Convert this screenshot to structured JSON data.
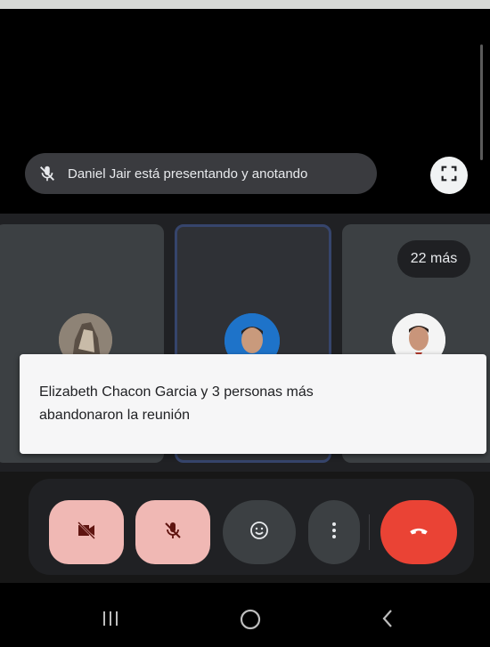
{
  "presentation": {
    "presenter_text": "Daniel Jair está presentando y anotando",
    "icons": {
      "mic_off": "mic-off-icon",
      "fullscreen": "fullscreen-icon"
    }
  },
  "participants": {
    "more_label": "22 más"
  },
  "toast": {
    "line1": "Elizabeth Chacon Garcia y 3 personas más",
    "line2": "abandonaron la reunión"
  },
  "controls": {
    "camera": "camera-off-icon",
    "microphone": "mic-off-icon",
    "reactions": "emoji-icon",
    "more": "more-vert-icon",
    "end_call": "call-end-icon"
  },
  "navigation": {
    "recents": "recents-icon",
    "home": "home-icon",
    "back": "back-icon"
  },
  "colors": {
    "end_call": "#ea4335",
    "muted_button": "#f0b8b4",
    "active_tile_border": "#36456c"
  }
}
